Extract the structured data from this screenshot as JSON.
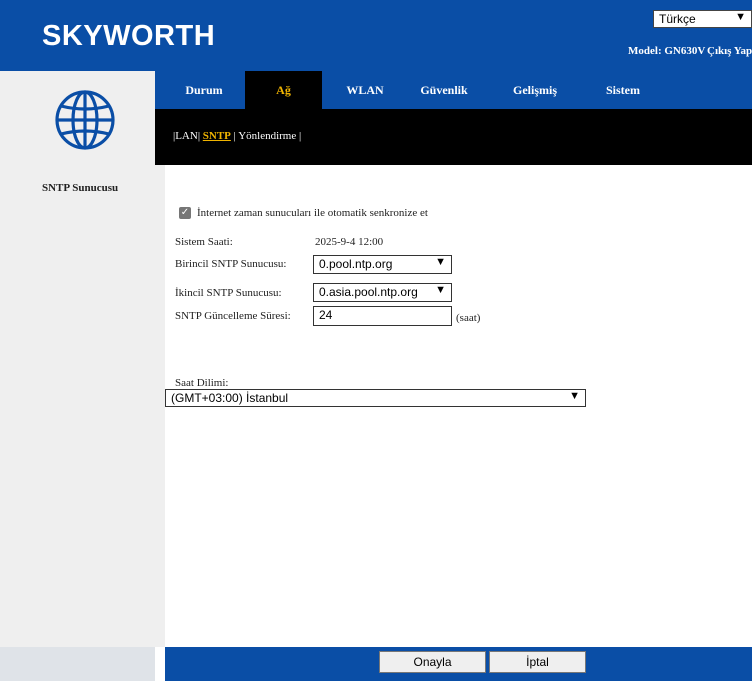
{
  "header": {
    "logo": "SKYWORTH",
    "language": "Türkçe",
    "model": "Model: GN630V",
    "logout": "Çıkış Yap"
  },
  "tabs": [
    {
      "label": "Durum"
    },
    {
      "label": "Ağ",
      "active": true
    },
    {
      "label": "WLAN"
    },
    {
      "label": "Güvenlik"
    },
    {
      "label": "Gelişmiş"
    },
    {
      "label": "Sistem"
    }
  ],
  "subnav": {
    "sep": "|",
    "lan": "LAN",
    "sntp": "SNTP",
    "routing": "Yönlendirme"
  },
  "sidebar": {
    "active_item": "SNTP Sunucusu"
  },
  "form": {
    "auto_sync_label": "İnternet zaman sunucuları ile otomatik senkronize et",
    "auto_sync_checked": true,
    "system_time_label": "Sistem Saati:",
    "system_time_value": "2025-9-4  12:00",
    "primary_label": "Birincil SNTP Sunucusu:",
    "primary_value": "0.pool.ntp.org",
    "secondary_label": "İkincil SNTP Sunucusu:",
    "secondary_value": "0.asia.pool.ntp.org",
    "interval_label": "SNTP Güncelleme Süresi:",
    "interval_value": "24",
    "interval_unit": "(saat)",
    "timezone_label": "Saat Dilimi:",
    "timezone_value": "(GMT+03:00) İstanbul"
  },
  "footer": {
    "apply": "Onayla",
    "cancel": "İptal"
  },
  "colors": {
    "brand_blue": "#0a4ea6",
    "active_tab_text": "#f0b400",
    "panel_gray": "#efefef"
  },
  "icons": {
    "globe": "globe-icon",
    "chevron": "chevron-down-icon",
    "check": "checkmark-icon"
  }
}
